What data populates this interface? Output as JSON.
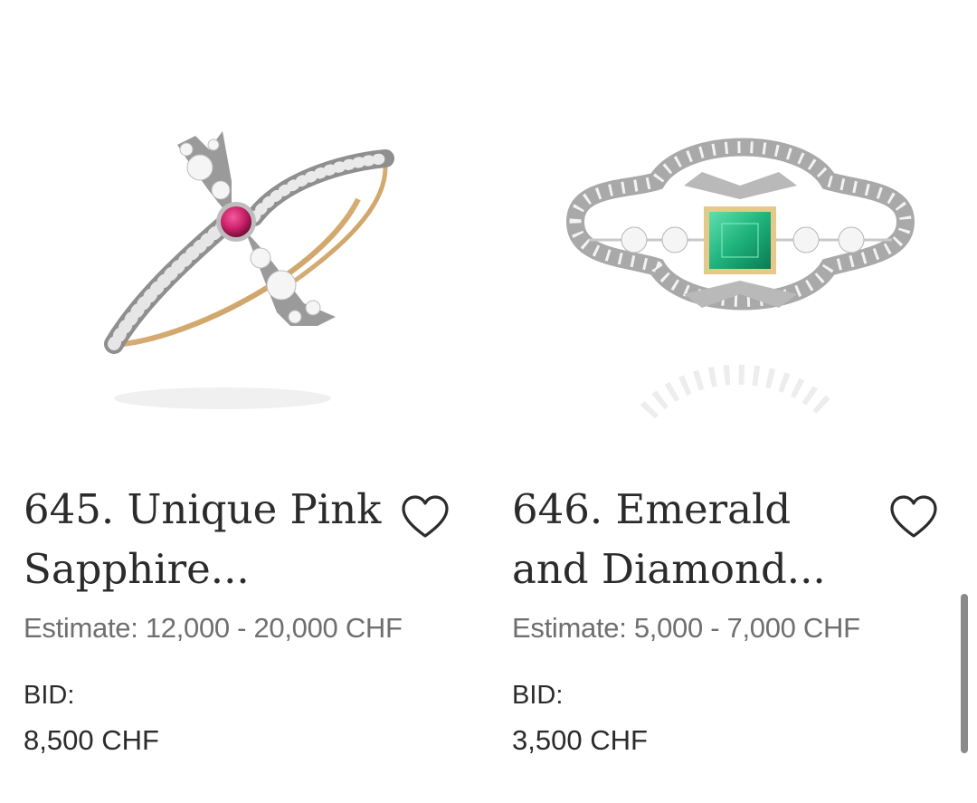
{
  "lots": [
    {
      "title": "645. Unique Pink Sapphire...",
      "estimate": "Estimate: 12,000 - 20,000 CHF",
      "bid_label": "BID:",
      "bid_value": "8,500 CHF",
      "favorite_icon": "heart-outline-icon"
    },
    {
      "title": "646. Emerald and Diamond...",
      "estimate": "Estimate: 5,000 - 7,000 CHF",
      "bid_label": "BID:",
      "bid_value": "3,500 CHF",
      "favorite_icon": "heart-outline-icon"
    }
  ],
  "colors": {
    "text": "#2b2b2b",
    "muted": "#6f6f6f",
    "sapphire": "#d0246c",
    "emerald": "#1fb27c",
    "gold": "#d2aa6a",
    "silver": "#8f8f8f"
  }
}
